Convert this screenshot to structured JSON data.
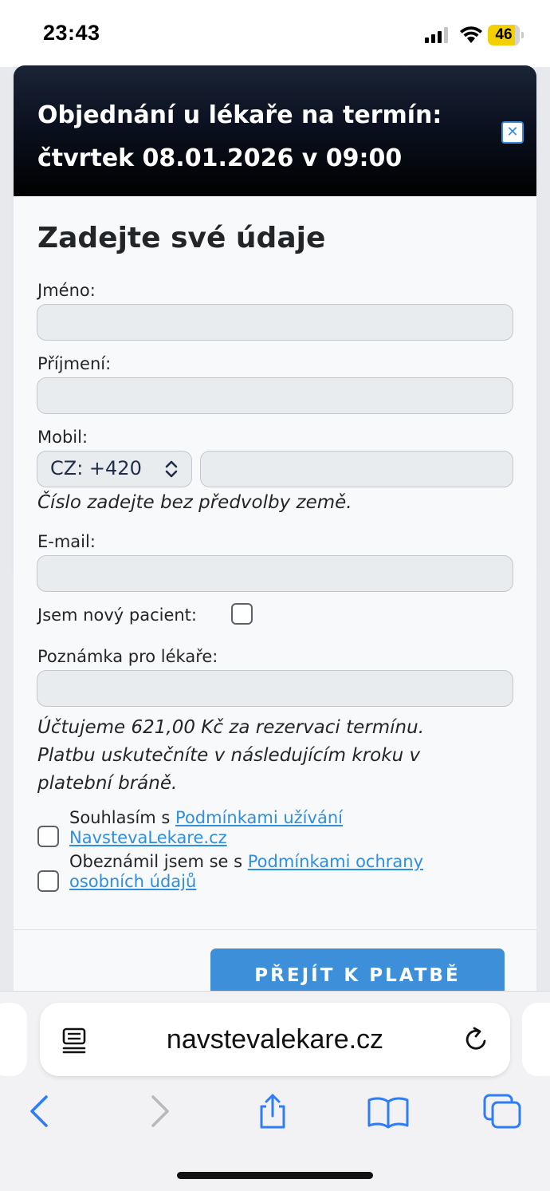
{
  "status_bar": {
    "time": "23:43",
    "battery": "46"
  },
  "modal": {
    "title_line1": "Objednání u lékaře na termín:",
    "title_line2": "čtvrtek 08.01.2026 v 09:00",
    "close_label": "✕"
  },
  "form": {
    "heading": "Zadejte své údaje",
    "first_name_label": "Jméno:",
    "first_name_value": "",
    "last_name_label": "Příjmení:",
    "last_name_value": "",
    "mobile_label": "Mobil:",
    "country_code": "CZ: +420",
    "mobile_value": "",
    "mobile_hint": "Číslo zadejte bez předvolby země.",
    "email_label": "E-mail:",
    "email_value": "",
    "new_patient_label": "Jsem nový pacient:",
    "note_label": "Poznámka pro lékaře:",
    "note_value": "",
    "payment_note_line1": "Účtujeme 621,00 Kč za rezervaci termínu.",
    "payment_note_line2": "Platbu uskutečníte v následujícím kroku v",
    "payment_note_line3": "platební bráně.",
    "consent_terms_prefix": "Souhlasím s ",
    "consent_terms_link_line1": "Podmínkami užívání",
    "consent_terms_link_line2": "NavstevaLekare.cz",
    "consent_privacy_prefix": "Obeznámil jsem se s ",
    "consent_privacy_link_line1": "Podmínkami ochrany",
    "consent_privacy_link_line2": "osobních údajů",
    "submit_label": "PŘEJÍT K PLATBĚ"
  },
  "browser": {
    "url": "navstevalekare.cz",
    "icons": [
      "reader-icon",
      "reload-icon",
      "back-icon",
      "forward-icon",
      "share-icon",
      "bookmarks-icon",
      "tabs-icon"
    ]
  }
}
